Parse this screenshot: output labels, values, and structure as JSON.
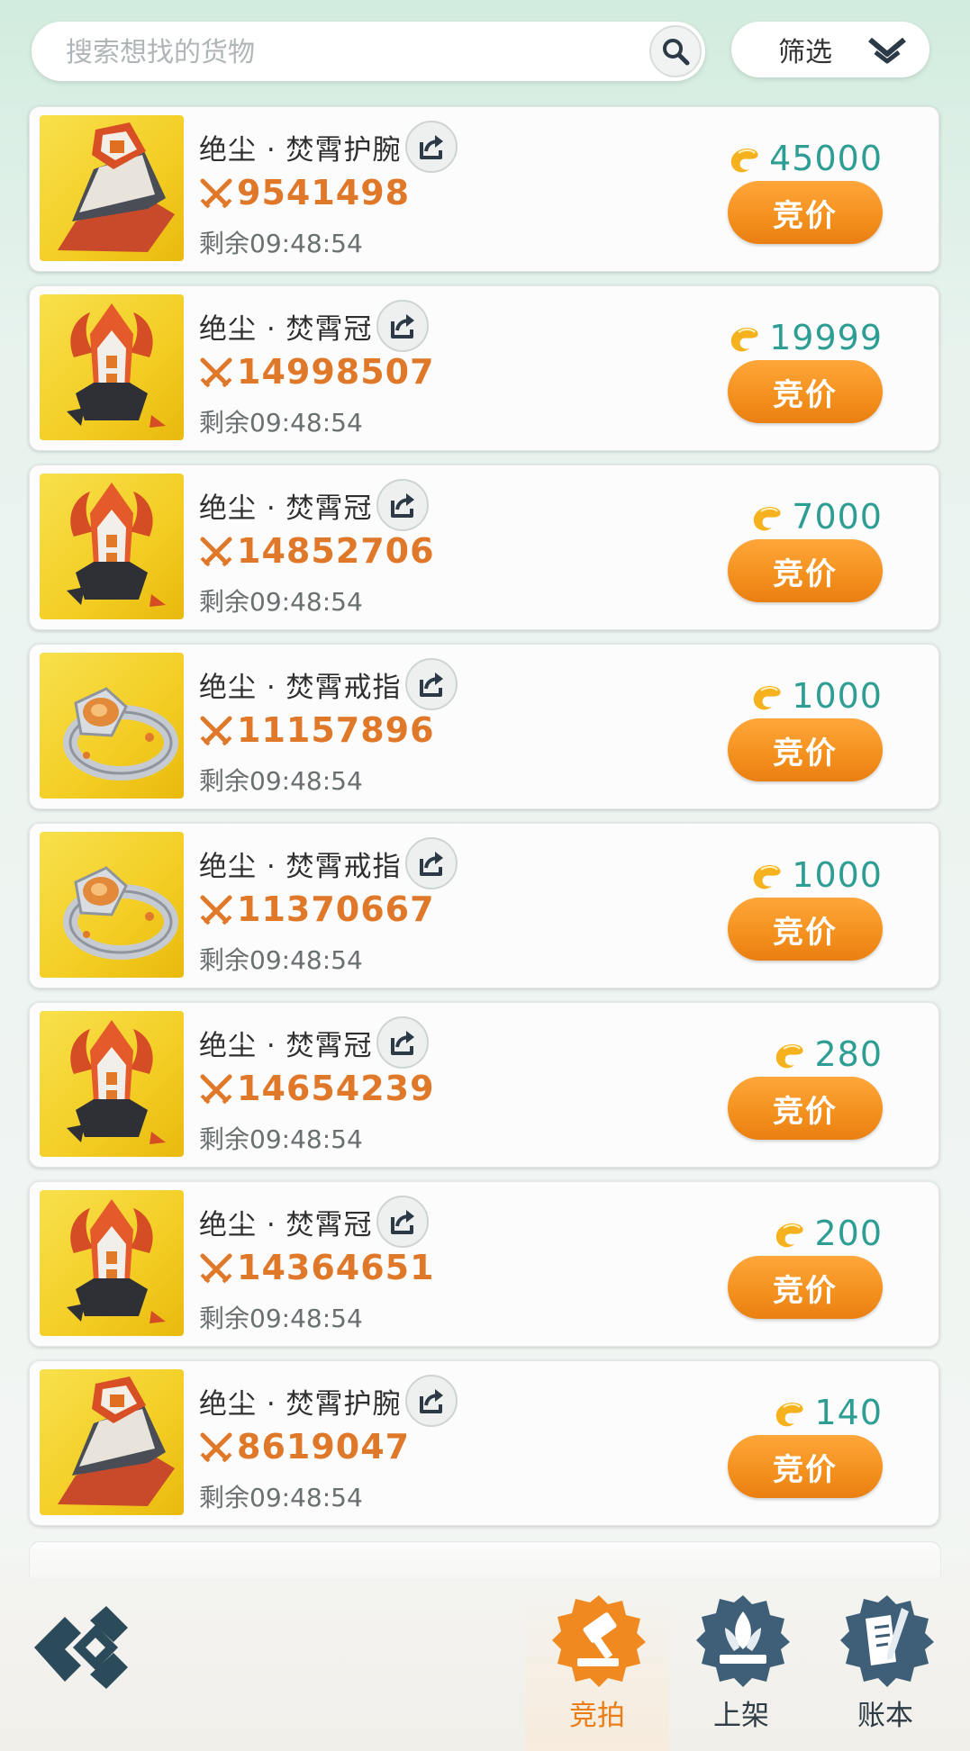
{
  "search": {
    "placeholder": "搜索想找的货物"
  },
  "filter": {
    "label": "筛选"
  },
  "items": [
    {
      "name": "绝尘 · 焚霄护腕",
      "power": "9541498",
      "remaining": "剩余09:48:54",
      "price": "45000",
      "bid_label": "竞价",
      "thumb_icon": "bracer-icon"
    },
    {
      "name": "绝尘 · 焚霄冠",
      "power": "14998507",
      "remaining": "剩余09:48:54",
      "price": "19999",
      "bid_label": "竞价",
      "thumb_icon": "crown-icon"
    },
    {
      "name": "绝尘 · 焚霄冠",
      "power": "14852706",
      "remaining": "剩余09:48:54",
      "price": "7000",
      "bid_label": "竞价",
      "thumb_icon": "crown-icon"
    },
    {
      "name": "绝尘 · 焚霄戒指",
      "power": "11157896",
      "remaining": "剩余09:48:54",
      "price": "1000",
      "bid_label": "竞价",
      "thumb_icon": "ring-icon"
    },
    {
      "name": "绝尘 · 焚霄戒指",
      "power": "11370667",
      "remaining": "剩余09:48:54",
      "price": "1000",
      "bid_label": "竞价",
      "thumb_icon": "ring-icon"
    },
    {
      "name": "绝尘 · 焚霄冠",
      "power": "14654239",
      "remaining": "剩余09:48:54",
      "price": "280",
      "bid_label": "竞价",
      "thumb_icon": "crown-icon"
    },
    {
      "name": "绝尘 · 焚霄冠",
      "power": "14364651",
      "remaining": "剩余09:48:54",
      "price": "200",
      "bid_label": "竞价",
      "thumb_icon": "crown-icon"
    },
    {
      "name": "绝尘 · 焚霄护腕",
      "power": "8619047",
      "remaining": "剩余09:48:54",
      "price": "140",
      "bid_label": "竞价",
      "thumb_icon": "bracer-icon"
    }
  ],
  "tabs": [
    {
      "label": "竞拍",
      "icon": "gavel-icon",
      "active": true
    },
    {
      "label": "上架",
      "icon": "leaf-shelf-icon",
      "active": false
    },
    {
      "label": "账本",
      "icon": "ledger-icon",
      "active": false
    }
  ],
  "colors": {
    "accent_orange": "#f3901d",
    "price_teal": "#2e9e94",
    "power_orange": "#e0782a"
  }
}
